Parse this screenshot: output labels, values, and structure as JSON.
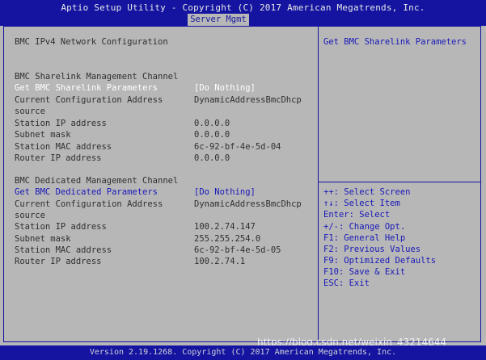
{
  "header": {
    "title": "Aptio Setup Utility - Copyright (C) 2017 American Megatrends, Inc.",
    "tab": "Server Mgmt"
  },
  "main": {
    "page_title": "BMC IPv4 Network Configuration",
    "sharelink": {
      "heading": "BMC Sharelink Management Channel",
      "rows": [
        {
          "label": "Get BMC Sharelink Parameters",
          "value": "[Do Nothing]"
        },
        {
          "label": "Current Configuration Address",
          "value": "DynamicAddressBmcDhcp"
        },
        {
          "label": "source",
          "value": ""
        },
        {
          "label": "Station IP address",
          "value": "0.0.0.0"
        },
        {
          "label": "Subnet mask",
          "value": "0.0.0.0"
        },
        {
          "label": "Station MAC address",
          "value": "6c-92-bf-4e-5d-04"
        },
        {
          "label": "Router IP address",
          "value": "0.0.0.0"
        }
      ]
    },
    "dedicated": {
      "heading": "BMC Dedicated Management Channel",
      "rows": [
        {
          "label": "Get BMC Dedicated Parameters",
          "value": "[Do Nothing]"
        },
        {
          "label": "Current Configuration Address",
          "value": "DynamicAddressBmcDhcp"
        },
        {
          "label": "source",
          "value": ""
        },
        {
          "label": "Station IP address",
          "value": "100.2.74.147"
        },
        {
          "label": "Subnet mask",
          "value": "255.255.254.0"
        },
        {
          "label": "Station MAC address",
          "value": "6c-92-bf-4e-5d-05"
        },
        {
          "label": "Router IP address",
          "value": "100.2.74.1"
        }
      ]
    }
  },
  "help": {
    "description": "Get BMC Sharelink Parameters",
    "keys": [
      "++: Select Screen",
      "↑↓: Select Item",
      "Enter: Select",
      "+/-: Change Opt.",
      "F1: General Help",
      "F2: Previous Values",
      "F9: Optimized Defaults",
      "F10: Save & Exit",
      "ESC: Exit"
    ]
  },
  "footer": {
    "version": "Version 2.19.1268. Copyright (C) 2017 American Megatrends, Inc."
  },
  "watermark": "https://blog.csdn.net/weixin_43214644",
  "colors": {
    "background": "#b7b7b7",
    "bar": "#1414a0",
    "highlight": "#1818b8",
    "selected": "#ffffff"
  }
}
